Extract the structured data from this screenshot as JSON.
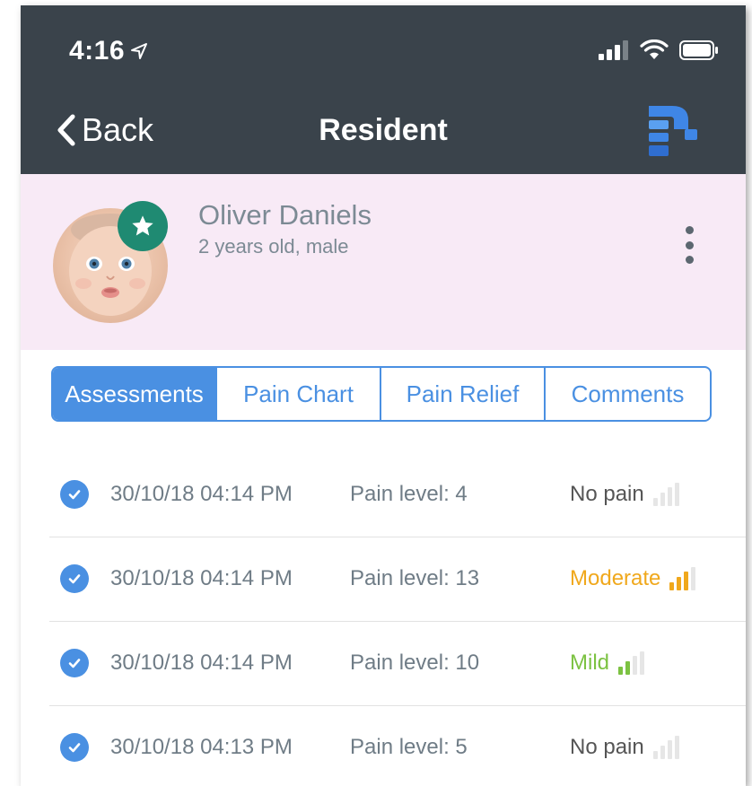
{
  "status_bar": {
    "time": "4:16"
  },
  "nav": {
    "back_label": "Back",
    "title": "Resident"
  },
  "patient": {
    "name": "Oliver Daniels",
    "meta": "2 years old, male"
  },
  "tabs": [
    {
      "label": "Assessments",
      "active": true
    },
    {
      "label": "Pain Chart",
      "active": false
    },
    {
      "label": "Pain Relief",
      "active": false
    },
    {
      "label": "Comments",
      "active": false
    }
  ],
  "assessments": [
    {
      "datetime": "30/10/18 04:14 PM",
      "pain_level": "Pain level: 4",
      "status": "No pain",
      "status_color": "#555555",
      "bars_filled": 0,
      "bar_color": "#e0e0e0"
    },
    {
      "datetime": "30/10/18 04:14 PM",
      "pain_level": "Pain level: 13",
      "status": "Moderate",
      "status_color": "#f0a81c",
      "bars_filled": 3,
      "bar_color": "#f0a81c"
    },
    {
      "datetime": "30/10/18 04:14 PM",
      "pain_level": "Pain level: 10",
      "status": "Mild",
      "status_color": "#7cc242",
      "bars_filled": 2,
      "bar_color": "#7cc242"
    },
    {
      "datetime": "30/10/18 04:13 PM",
      "pain_level": "Pain level: 5",
      "status": "No pain",
      "status_color": "#555555",
      "bars_filled": 0,
      "bar_color": "#e0e0e0"
    }
  ],
  "colors": {
    "nav_bg": "#3a434b",
    "profile_bg": "#f8eaf6",
    "accent": "#4a90e2",
    "badge": "#1f8a72"
  }
}
